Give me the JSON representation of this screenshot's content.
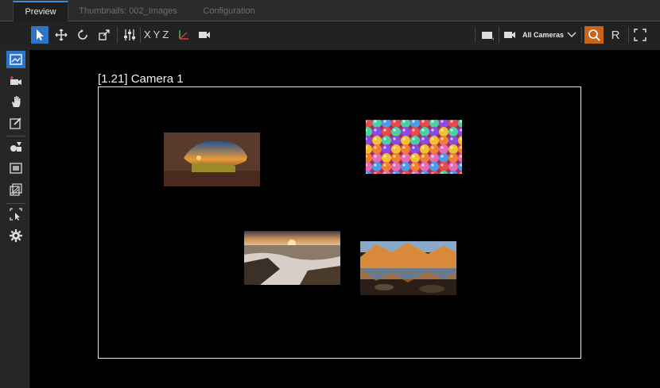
{
  "tabs": [
    {
      "label": "Preview",
      "active": true
    },
    {
      "label": "Thumbnails: 002_Images",
      "active": false
    },
    {
      "label": "Configuration",
      "active": false
    }
  ],
  "toolbar": {
    "axes_label": "XYZ",
    "camera_select": "All Cameras",
    "reset_label": "R"
  },
  "viewport": {
    "camera_label": "[1.21] Camera 1"
  },
  "images": [
    {
      "name": "cave-sunset-image"
    },
    {
      "name": "colorful-spheres-image"
    },
    {
      "name": "ocean-sunset-image"
    },
    {
      "name": "mountain-lake-image"
    }
  ],
  "colors": {
    "accent": "#2e74c9",
    "search_active": "#c7651b",
    "frame": "#e8e8e8"
  }
}
